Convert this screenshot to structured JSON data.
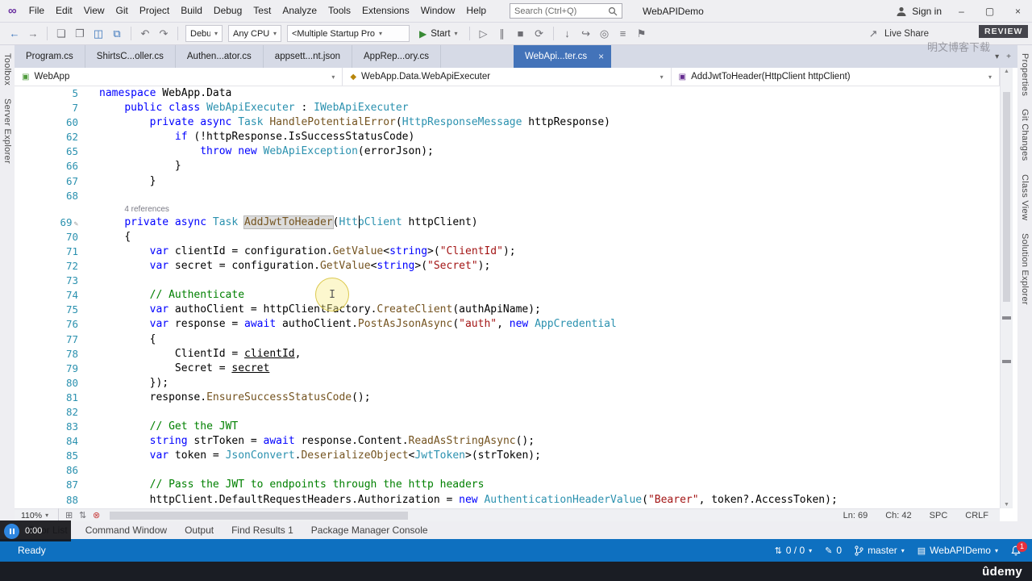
{
  "colors": {
    "keyword": "#0000FF",
    "type": "#2B91AF",
    "string": "#A31515",
    "comment": "#008000",
    "method": "#74531F",
    "line_number": "#2B91AF",
    "active_tab": "#4373B9",
    "status_bar": "#0E70C0",
    "start_button": "#388A34",
    "error_red": "#C84040",
    "accent": "#3B76BC"
  },
  "window": {
    "title": "WebAPIDemo",
    "search_placeholder": "Search (Ctrl+Q)",
    "sign_in": "Sign in"
  },
  "menu": {
    "items": [
      "File",
      "Edit",
      "View",
      "Git",
      "Project",
      "Build",
      "Debug",
      "Test",
      "Analyze",
      "Tools",
      "Extensions",
      "Window",
      "Help"
    ]
  },
  "toolbar": {
    "icons_nav": [
      {
        "name": "nav-backward-icon",
        "glyph": "←",
        "cls": "blue"
      },
      {
        "name": "nav-forward-icon",
        "glyph": "→",
        "cls": "gray"
      }
    ],
    "icons_file": [
      {
        "name": "new-file-icon",
        "glyph": "❏",
        "cls": "gray"
      },
      {
        "name": "open-file-icon",
        "glyph": "❐",
        "cls": "gray"
      },
      {
        "name": "save-icon",
        "glyph": "◫",
        "cls": "blue"
      },
      {
        "name": "save-all-icon",
        "glyph": "⧉",
        "cls": "blue"
      }
    ],
    "icons_undo": [
      {
        "name": "undo-icon",
        "glyph": "↶",
        "cls": "gray"
      },
      {
        "name": "redo-icon",
        "glyph": "↷",
        "cls": "gray"
      }
    ],
    "dropdowns": [
      {
        "name": "configuration-dropdown",
        "label": "Debu"
      },
      {
        "name": "platform-dropdown",
        "label": "Any CPU"
      },
      {
        "name": "startup-project-dropdown",
        "label": "<Multiple Startup Pro"
      }
    ],
    "start_label": "Start",
    "icons_debug": [
      {
        "name": "run-without-debug-icon",
        "glyph": "▷",
        "cls": "gray"
      },
      {
        "name": "break-all-icon",
        "glyph": "∥",
        "cls": "gray"
      },
      {
        "name": "stop-icon",
        "glyph": "■",
        "cls": "gray"
      },
      {
        "name": "restart-icon",
        "glyph": "⟳",
        "cls": "gray"
      }
    ],
    "icons_misc": [
      {
        "name": "step-into-icon",
        "glyph": "↓",
        "cls": "gray"
      },
      {
        "name": "step-over-icon",
        "glyph": "↪",
        "cls": "gray"
      },
      {
        "name": "find-in-files-icon",
        "glyph": "◎",
        "cls": "gray"
      },
      {
        "name": "comment-icon",
        "glyph": "≡",
        "cls": "gray"
      },
      {
        "name": "bookmark-icon",
        "glyph": "⚑",
        "cls": "gray"
      }
    ],
    "live_share": {
      "glyph": "↗",
      "label": "Live Share"
    }
  },
  "tabs": [
    {
      "label": "Program.cs",
      "active": false
    },
    {
      "label": "ShirtsC...oller.cs",
      "active": false
    },
    {
      "label": "Authen...ator.cs",
      "active": false
    },
    {
      "label": "appsett...nt.json",
      "active": false
    },
    {
      "label": "AppRep...ory.cs",
      "active": false
    },
    {
      "label": "WebApi...ter.cs",
      "active": true
    }
  ],
  "doc_well": [
    {
      "name": "tab-overflow-icon",
      "glyph": "▾"
    },
    {
      "name": "float-tab-icon",
      "glyph": "+"
    }
  ],
  "breadcrumb": [
    {
      "label": "WebApp",
      "icon": "project-icon",
      "glyph": "▣",
      "color": "#4F9B3C"
    },
    {
      "label": "WebApp.Data.WebApiExecuter",
      "icon": "class-icon",
      "glyph": "◆",
      "color": "#B8860B"
    },
    {
      "label": "AddJwtToHeader(HttpClient httpClient)",
      "icon": "method-icon",
      "glyph": "▣",
      "color": "#652D90"
    }
  ],
  "left_rail": [
    "Toolbox",
    "Server Explorer"
  ],
  "right_rail": [
    "Properties",
    "Git Changes",
    "Class View",
    "Solution Explorer"
  ],
  "editor": {
    "zoom": "110%",
    "position": [
      "Ln: 69",
      "Ch: 42",
      "SPC",
      "CRLF"
    ],
    "scroll_icons": [
      {
        "name": "pan-view-icon",
        "glyph": "⊞",
        "cls": "gray"
      },
      {
        "name": "sync-view-icon",
        "glyph": "⇅",
        "cls": "gray"
      },
      {
        "name": "error-indicator-icon",
        "glyph": "⊗",
        "cls": "red"
      }
    ],
    "lines": [
      {
        "n": "5",
        "ind": 0,
        "seg": [
          [
            "namespace ",
            "kw"
          ],
          [
            "WebApp.Data",
            "pl"
          ]
        ]
      },
      {
        "n": "7",
        "ind": 4,
        "seg": [
          [
            "public class ",
            "kw"
          ],
          [
            "WebApiExecuter",
            "ty"
          ],
          [
            " : ",
            "pl"
          ],
          [
            "IWebApiExecuter",
            "ty"
          ]
        ]
      },
      {
        "n": "60",
        "ind": 8,
        "seg": [
          [
            "private async ",
            "kw"
          ],
          [
            "Task",
            "ty"
          ],
          [
            " ",
            "pl"
          ],
          [
            "HandlePotentialError",
            "me"
          ],
          [
            "(",
            "pl"
          ],
          [
            "HttpResponseMessage",
            "ty"
          ],
          [
            " httpResponse)",
            "pl"
          ]
        ]
      },
      {
        "n": "62",
        "ind": 12,
        "seg": [
          [
            "if",
            "kw"
          ],
          [
            " (!httpResponse.IsSuccessStatusCode)",
            "pl"
          ]
        ]
      },
      {
        "n": "65",
        "ind": 16,
        "seg": [
          [
            "throw new ",
            "kw"
          ],
          [
            "WebApiException",
            "ty"
          ],
          [
            "(errorJson);",
            "pl"
          ]
        ]
      },
      {
        "n": "66",
        "ind": 12,
        "seg": [
          [
            "}",
            "pl"
          ]
        ]
      },
      {
        "n": "67",
        "ind": 8,
        "seg": [
          [
            "}",
            "pl"
          ]
        ]
      },
      {
        "n": "68",
        "ind": 0,
        "seg": []
      },
      {
        "lens": "4 references",
        "ind": 4
      },
      {
        "n": "69",
        "ind": 4,
        "mark": true,
        "seg": [
          [
            "private async ",
            "kw"
          ],
          [
            "Task",
            "ty"
          ],
          [
            " ",
            "pl"
          ],
          [
            "AddJwtToHeader",
            "hl"
          ],
          [
            "(",
            "pl"
          ],
          [
            "HttpClient",
            "ty"
          ],
          [
            " httpClient)",
            "pl"
          ]
        ]
      },
      {
        "n": "70",
        "ind": 4,
        "seg": [
          [
            "{",
            "pl"
          ]
        ]
      },
      {
        "n": "71",
        "ind": 8,
        "seg": [
          [
            "var",
            "kw"
          ],
          [
            " clientId = configuration.",
            "pl"
          ],
          [
            "GetValue",
            "me"
          ],
          [
            "<",
            "pl"
          ],
          [
            "string",
            "kw"
          ],
          [
            ">(",
            "pl"
          ],
          [
            "\"ClientId\"",
            "st"
          ],
          [
            ");",
            "pl"
          ]
        ]
      },
      {
        "n": "72",
        "ind": 8,
        "seg": [
          [
            "var",
            "kw"
          ],
          [
            " secret = configuration.",
            "pl"
          ],
          [
            "GetValue",
            "me"
          ],
          [
            "<",
            "pl"
          ],
          [
            "string",
            "kw"
          ],
          [
            ">(",
            "pl"
          ],
          [
            "\"Secret\"",
            "st"
          ],
          [
            ");",
            "pl"
          ]
        ]
      },
      {
        "n": "73",
        "ind": 0,
        "seg": []
      },
      {
        "n": "74",
        "ind": 8,
        "seg": [
          [
            "// Authenticate",
            "co"
          ]
        ]
      },
      {
        "n": "75",
        "ind": 8,
        "seg": [
          [
            "var",
            "kw"
          ],
          [
            " authoClient = httpClientFactory.",
            "pl"
          ],
          [
            "CreateClient",
            "me"
          ],
          [
            "(authApiName);",
            "pl"
          ]
        ]
      },
      {
        "n": "76",
        "ind": 8,
        "seg": [
          [
            "var",
            "kw"
          ],
          [
            " response = ",
            "pl"
          ],
          [
            "await",
            "kw"
          ],
          [
            " authoClient.",
            "pl"
          ],
          [
            "PostAsJsonAsync",
            "me"
          ],
          [
            "(",
            "pl"
          ],
          [
            "\"auth\"",
            "st"
          ],
          [
            ", ",
            "pl"
          ],
          [
            "new ",
            "kw"
          ],
          [
            "AppCredential",
            "ty"
          ]
        ]
      },
      {
        "n": "77",
        "ind": 8,
        "seg": [
          [
            "{",
            "pl"
          ]
        ]
      },
      {
        "n": "78",
        "ind": 12,
        "seg": [
          [
            "ClientId = ",
            "pl"
          ],
          [
            "clientId",
            "un"
          ],
          [
            ",",
            "pl"
          ]
        ]
      },
      {
        "n": "79",
        "ind": 12,
        "seg": [
          [
            "Secret = ",
            "pl"
          ],
          [
            "secret",
            "un"
          ]
        ]
      },
      {
        "n": "80",
        "ind": 8,
        "seg": [
          [
            "});",
            "pl"
          ]
        ]
      },
      {
        "n": "81",
        "ind": 8,
        "seg": [
          [
            "response.",
            "pl"
          ],
          [
            "EnsureSuccessStatusCode",
            "me"
          ],
          [
            "();",
            "pl"
          ]
        ]
      },
      {
        "n": "82",
        "ind": 0,
        "seg": []
      },
      {
        "n": "83",
        "ind": 8,
        "seg": [
          [
            "// Get the JWT",
            "co"
          ]
        ]
      },
      {
        "n": "84",
        "ind": 8,
        "seg": [
          [
            "string",
            "kw"
          ],
          [
            " strToken = ",
            "pl"
          ],
          [
            "await",
            "kw"
          ],
          [
            " response.Content.",
            "pl"
          ],
          [
            "ReadAsStringAsync",
            "me"
          ],
          [
            "();",
            "pl"
          ]
        ]
      },
      {
        "n": "85",
        "ind": 8,
        "seg": [
          [
            "var",
            "kw"
          ],
          [
            " token = ",
            "pl"
          ],
          [
            "JsonConvert",
            "ty"
          ],
          [
            ".",
            "pl"
          ],
          [
            "DeserializeObject",
            "me"
          ],
          [
            "<",
            "pl"
          ],
          [
            "JwtToken",
            "ty"
          ],
          [
            ">(strToken);",
            "pl"
          ]
        ]
      },
      {
        "n": "86",
        "ind": 0,
        "seg": []
      },
      {
        "n": "87",
        "ind": 8,
        "seg": [
          [
            "// Pass the JWT to endpoints through the http headers",
            "co"
          ]
        ]
      },
      {
        "n": "88",
        "ind": 8,
        "seg": [
          [
            "httpClient.DefaultRequestHeaders.Authorization = ",
            "pl"
          ],
          [
            "new ",
            "kw"
          ],
          [
            "AuthenticationHeaderValue",
            "ty"
          ],
          [
            "(",
            "pl"
          ],
          [
            "\"Bearer\"",
            "st"
          ],
          [
            ", token?.AccessToken);",
            "pl"
          ]
        ]
      }
    ]
  },
  "panels": [
    "Error List",
    "Command Window",
    "Output",
    "Find Results 1",
    "Package Manager Console"
  ],
  "status": {
    "ready": "Ready",
    "sync_counts": "0 / 0",
    "pending_changes": "0",
    "branch": "master",
    "repo": "WebAPIDemo",
    "notifications": "1"
  },
  "video": {
    "time": "0:00",
    "brand": "ûdemy"
  },
  "watermark": {
    "text": "明文博客下载",
    "badge": "REVIEW"
  }
}
